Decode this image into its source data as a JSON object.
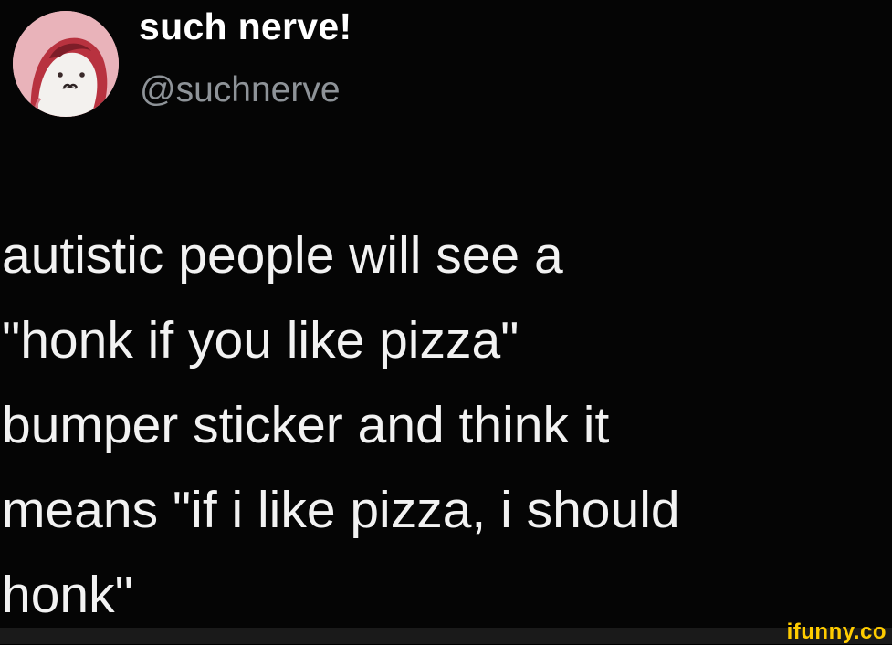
{
  "author": {
    "display_name": "such nerve!",
    "handle": "@suchnerve",
    "avatar_icon": "cartoon-character-avatar-icon"
  },
  "tweet": {
    "text": "autistic people will see a\n\"honk if you like pizza\"\nbumper sticker and think it\nmeans \"if i like pizza, i should\nhonk\""
  },
  "watermark": {
    "text": "ifunny.co",
    "color": "#ffcc00"
  },
  "colors": {
    "background": "#050505",
    "text": "#f2f2f2",
    "handle": "#8e9398",
    "avatar_bg": "#e8b8be"
  }
}
